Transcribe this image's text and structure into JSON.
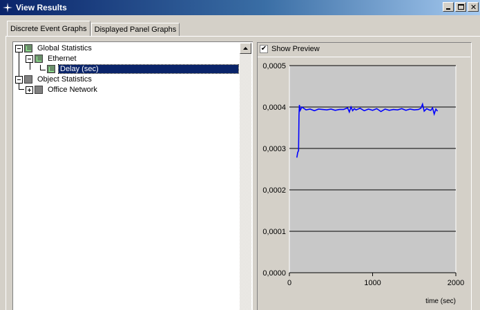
{
  "window": {
    "title": "View Results",
    "app_icon": "star-icon",
    "controls": [
      "minimize-icon",
      "maximize-icon",
      "close-icon"
    ]
  },
  "tabs": [
    {
      "label": "Discrete Event Graphs",
      "active": true
    },
    {
      "label": "Displayed Panel Graphs",
      "active": false
    }
  ],
  "tree": {
    "items": [
      {
        "label": "Global Statistics",
        "expander": "minus"
      },
      {
        "label": "Ethernet",
        "expander": "minus"
      },
      {
        "label": "Delay (sec)",
        "selected": true
      },
      {
        "label": "Object Statistics",
        "expander": "minus"
      },
      {
        "label": "Office Network",
        "expander": "plus"
      }
    ]
  },
  "preview": {
    "checkbox_label": "Show Preview",
    "checked": true
  },
  "chart_data": {
    "type": "line",
    "title": "",
    "xlabel": "time (sec)",
    "ylabel": "",
    "xlim": [
      0,
      2000
    ],
    "ylim": [
      0,
      0.0005
    ],
    "x_ticks": [
      0,
      1000,
      2000
    ],
    "x_tick_labels": [
      "0",
      "1000",
      "2000"
    ],
    "y_ticks": [
      0,
      0.0001,
      0.0002,
      0.0003,
      0.0004,
      0.0005
    ],
    "y_tick_labels": [
      "0,0000",
      "0,0001",
      "0,0002",
      "0,0003",
      "0,0004",
      "0,0005"
    ],
    "grid": "horizontal",
    "background": "#c8c8c8",
    "line_color": "#0000ff",
    "series": [
      {
        "x": [
          90,
          100,
          110,
          115,
          120,
          130,
          150,
          200,
          250,
          300,
          350,
          400,
          450,
          500,
          550,
          600,
          650,
          700,
          720,
          740,
          760,
          780,
          800,
          850,
          900,
          950,
          1000,
          1050,
          1100,
          1150,
          1200,
          1250,
          1300,
          1350,
          1400,
          1450,
          1500,
          1550,
          1580,
          1600,
          1620,
          1650,
          1680,
          1700,
          1720,
          1740,
          1760,
          1780
        ],
        "y": [
          0.000278,
          0.00029,
          0.000295,
          0.00038,
          0.000405,
          0.000392,
          0.0004,
          0.000393,
          0.000395,
          0.000391,
          0.000395,
          0.000394,
          0.000393,
          0.000395,
          0.000392,
          0.000394,
          0.000394,
          0.000398,
          0.000388,
          0.0004,
          0.000391,
          0.000396,
          0.000393,
          0.000397,
          0.000391,
          0.000395,
          0.000392,
          0.000396,
          0.000389,
          0.000395,
          0.000392,
          0.000394,
          0.000393,
          0.000396,
          0.000392,
          0.000395,
          0.000393,
          0.000394,
          0.000397,
          0.000407,
          0.00039,
          0.000396,
          0.000393,
          0.000392,
          0.000398,
          0.000383,
          0.000395,
          0.00039
        ]
      }
    ]
  }
}
